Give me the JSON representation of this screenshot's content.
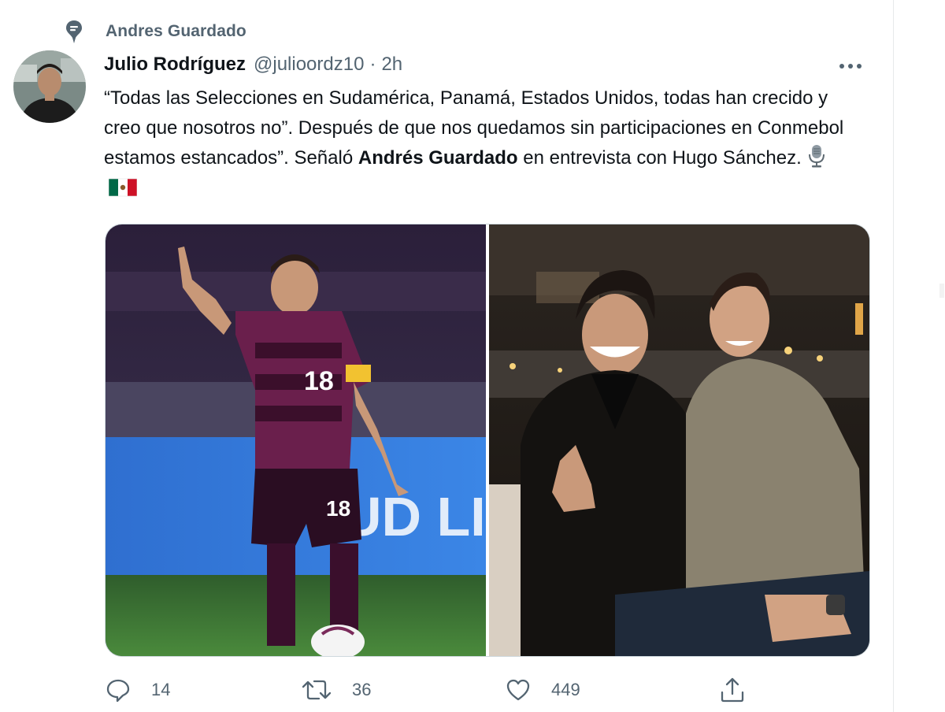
{
  "context": {
    "pinned_label": "Andres Guardado",
    "icon": "pin-icon"
  },
  "author": {
    "name": "Julio Rodríguez",
    "handle": "@julioordz10",
    "separator": "·",
    "time": "2h",
    "avatar_icon": "avatar"
  },
  "tweet": {
    "text_part1": "“Todas las Selecciones en Sudamérica, Panamá, Estados Unidos, todas han crecido y creo que nosotros no”. Después de que nos quedamos sin participaciones en Conmebol estamos estancados”. Señaló ",
    "mention_bold": "Andrés Guardado",
    "text_part2": " en entrevista con Hugo Sánchez. "
  },
  "actions": {
    "reply_count": "14",
    "retweet_count": "36",
    "like_count": "449"
  },
  "colors": {
    "text": "#0f1419",
    "secondary": "#536471",
    "border": "#cfd9de"
  }
}
